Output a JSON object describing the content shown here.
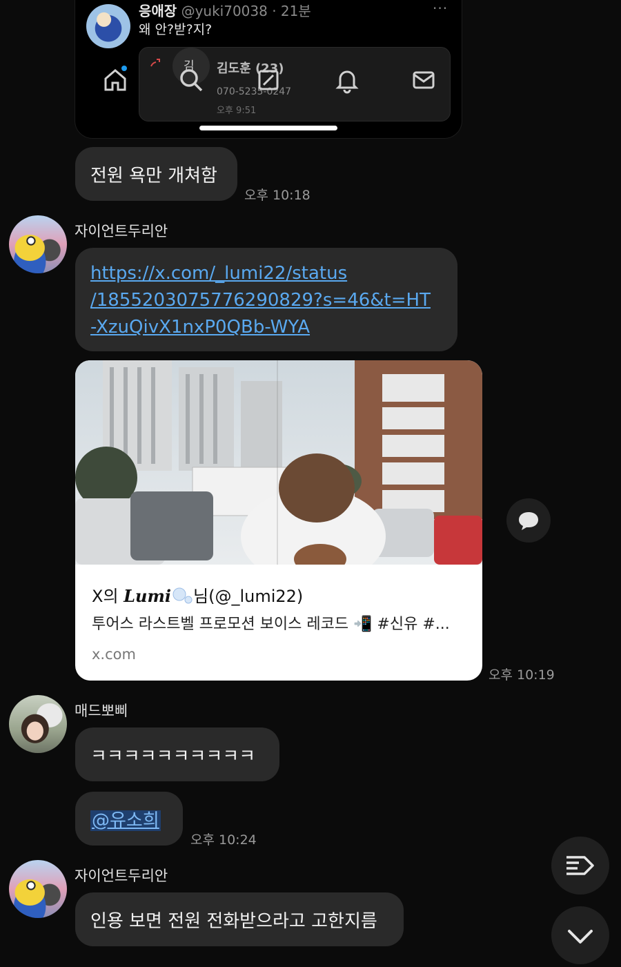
{
  "tweet": {
    "author_name": "응애장",
    "author_handle": "@yuki70038 · 21분",
    "text": "왜 안?받?지?",
    "more": "···",
    "call": {
      "initial": "김",
      "name": "김도훈 (23)",
      "number": "070-5235-0247",
      "time": "오후 9:51"
    },
    "nav_icons": [
      "home-icon",
      "search-icon",
      "compose-icon",
      "bell-icon",
      "mail-icon"
    ]
  },
  "messages": {
    "m1": {
      "text": "전원 욕만 개쳐함",
      "time": "오후 10:18"
    },
    "giant": {
      "sender": "자이언트두리안",
      "link_lines": [
        "https://x.com/_lumi22/status",
        "/1855203075776290829?s=46&t=HT",
        "-XzuQivX1nxP0QBb-WYA"
      ]
    },
    "preview": {
      "title_prefix": "X의",
      "title_name": "Lumi",
      "title_suffix": "님(@_lumi22)",
      "description": "투어스 라스트벨 프로모션 보이스 레코드 📲 #신유 #...",
      "domain": "x.com",
      "time": "오후 10:19"
    },
    "mad": {
      "sender": "매드뽀삐",
      "text": "ㅋㅋㅋㅋㅋㅋㅋㅋㅋㅋ",
      "mention": "@유소희",
      "time": "오후 10:24"
    },
    "giant2": {
      "sender": "자이언트두리안",
      "text": "인용 보면 전원 전화받으라고 고한지름"
    }
  },
  "colors": {
    "background": "#0b0b0b",
    "bubble": "#2a2a2a",
    "link": "#5aa9f0"
  }
}
